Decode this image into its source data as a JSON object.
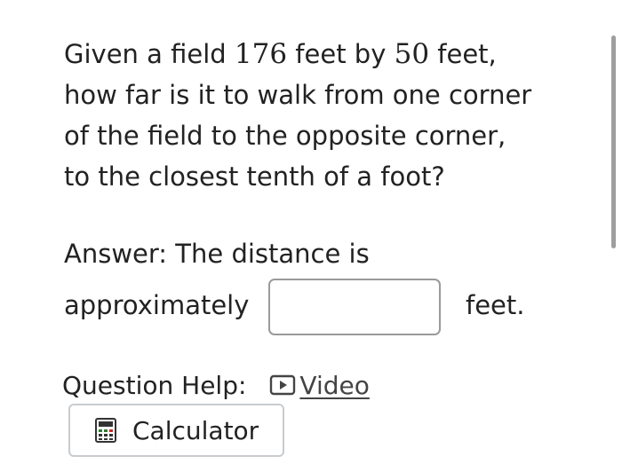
{
  "question": {
    "line1_pre": "Given a field ",
    "length": "176",
    "line1_mid": " feet by ",
    "width": "50",
    "line1_post": " feet,",
    "line2": "how far is it to walk from one corner",
    "line3": "of the field to the opposite corner,",
    "line4": "to the closest tenth of a foot?"
  },
  "answer": {
    "line1": "Answer: The distance is",
    "line2": "approximately",
    "input_value": "",
    "unit": "feet."
  },
  "help": {
    "label": "Question Help:",
    "video_label": "Video",
    "calculator_label": "Calculator"
  },
  "icons": {
    "video": "play-icon",
    "calculator": "calculator-icon"
  }
}
